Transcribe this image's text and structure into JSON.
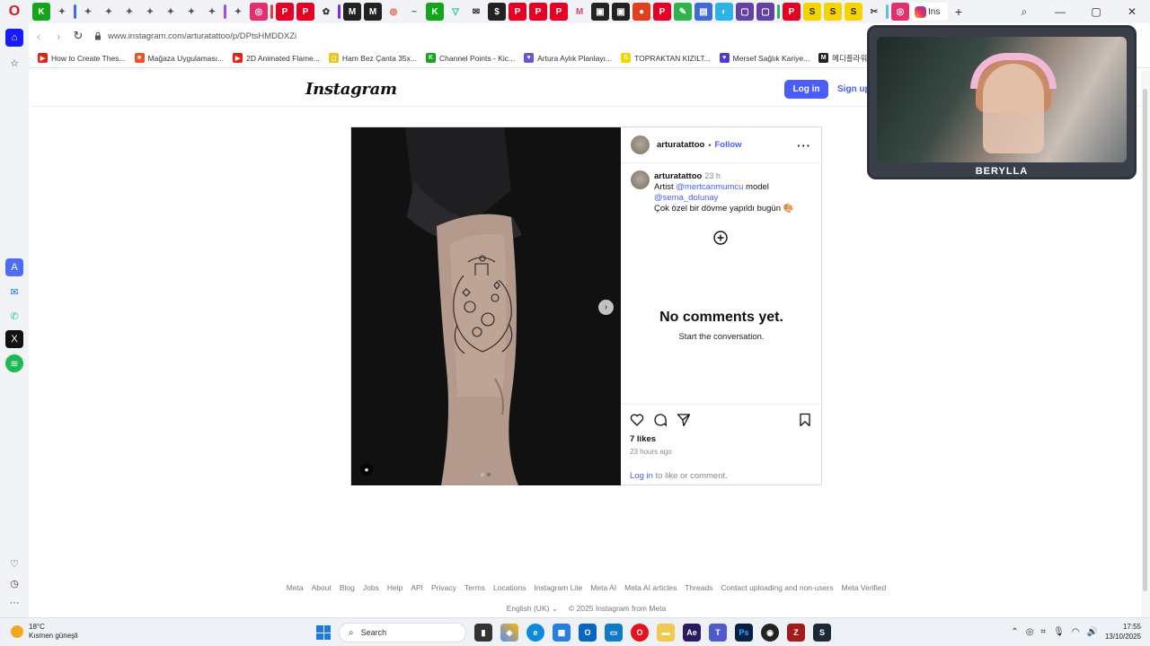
{
  "browser": {
    "url": "www.instagram.com/arturatattoo/p/DPtsHMDDXZi",
    "active_tab_label": "Ins",
    "bookmarks": [
      {
        "label": "How to Create Thes...",
        "color": "#e62117",
        "glyph": "▶"
      },
      {
        "label": "Mağaza Uygulaması...",
        "color": "#f25022",
        "glyph": "■"
      },
      {
        "label": "2D Animated Flame...",
        "color": "#e62117",
        "glyph": "▶"
      },
      {
        "label": "Ham Bez Çanta 35x...",
        "color": "#f0c419",
        "glyph": "◻"
      },
      {
        "label": "Channel Points - Kic...",
        "color": "#14a51b",
        "glyph": "K"
      },
      {
        "label": "Artura Aylık Planlayı...",
        "color": "#6b52d8",
        "glyph": "♥"
      },
      {
        "label": "TOPRAKTAN KIZILT...",
        "color": "#f5d400",
        "glyph": "S"
      },
      {
        "label": "Mersef Sağlık Kariye...",
        "color": "#4f3bd4",
        "glyph": "♥"
      },
      {
        "label": "메디플라워",
        "color": "#222222",
        "glyph": "M"
      }
    ]
  },
  "instagram": {
    "logo": "Instagram",
    "login_button": "Log in",
    "signup_link": "Sign up",
    "post": {
      "username": "arturatattoo",
      "follow": "Follow",
      "more": "···",
      "caption_username": "arturatattoo",
      "caption_time": "23 h",
      "caption_line1_prefix": "Artist ",
      "caption_mention1": "@mertcanmumcu",
      "caption_line1_suffix": " model",
      "caption_mention2": "@sema_dolunay",
      "caption_line2": "Çok özel bir dövme yapıldı bugün 🎨",
      "no_comments_title": "No comments yet.",
      "no_comments_sub": "Start the conversation.",
      "likes": "7 likes",
      "posted_ago": "23 hours ago",
      "login_link": "Log in",
      "login_suffix": " to like or comment."
    },
    "footer_links": [
      "Meta",
      "About",
      "Blog",
      "Jobs",
      "Help",
      "API",
      "Privacy",
      "Terms",
      "Locations",
      "Instagram Lite",
      "Meta AI",
      "Meta AI articles",
      "Threads",
      "Contact uploading and non-users",
      "Meta Verified"
    ],
    "language": "English (UK)",
    "copyright": "© 2025 Instagram from Meta"
  },
  "stream_overlay": {
    "name": "BERYLLA"
  },
  "taskbar": {
    "temperature": "18°C",
    "weather": "Kısmen güneşli",
    "search_placeholder": "Search",
    "time": "17:55",
    "date": "13/10/2025"
  }
}
